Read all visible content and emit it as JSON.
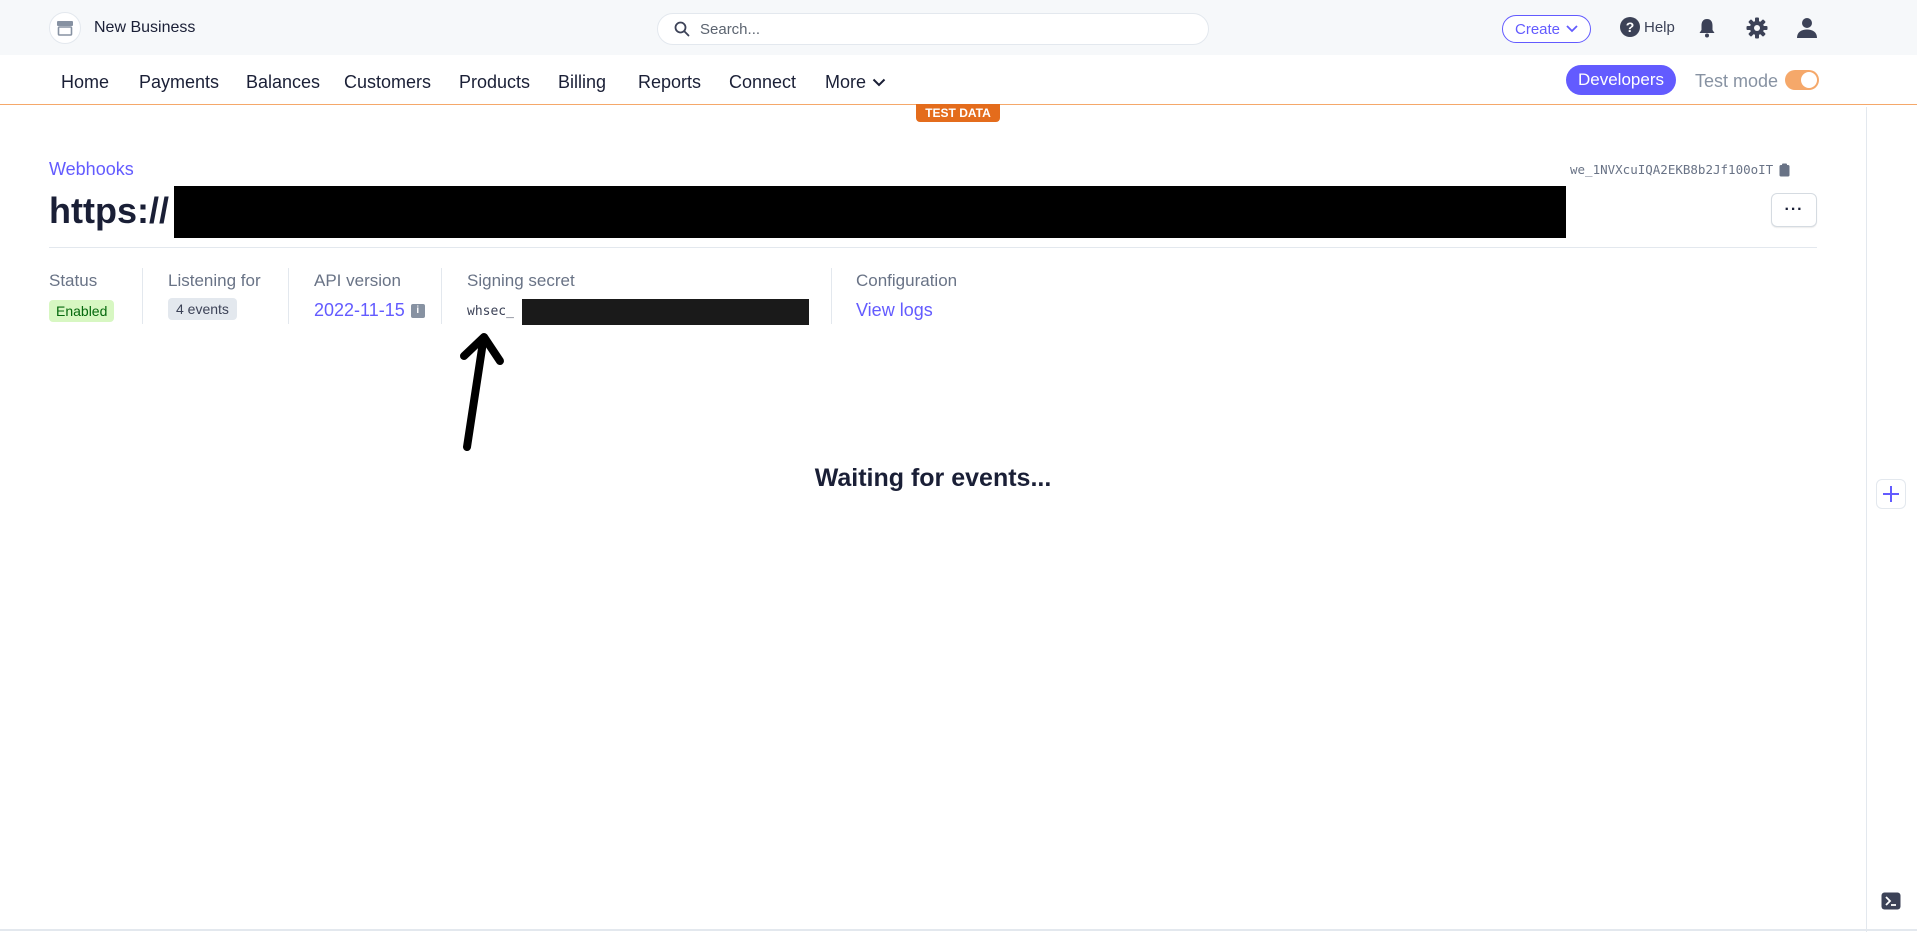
{
  "topbar": {
    "business_name": "New Business",
    "search_placeholder": "Search...",
    "create_label": "Create",
    "help_label": "Help"
  },
  "nav": {
    "items": [
      "Home",
      "Payments",
      "Balances",
      "Customers",
      "Products",
      "Billing",
      "Reports",
      "Connect"
    ],
    "more_label": "More",
    "developers_label": "Developers",
    "test_mode_label": "Test mode",
    "test_mode_on": true
  },
  "test_data_label": "TEST DATA",
  "webhook": {
    "breadcrumb": "Webhooks",
    "endpoint_id": "we_1NVXcuIQA2EKB8b2Jf100oIT",
    "title_prefix": "https://",
    "more_button": "···",
    "status_label": "Status",
    "status_value": "Enabled",
    "listening_label": "Listening for",
    "listening_value": "4 events",
    "api_label": "API version",
    "api_value": "2022-11-15",
    "secret_label": "Signing secret",
    "secret_prefix": "whsec_",
    "config_label": "Configuration",
    "view_logs": "View logs",
    "empty_state": "Waiting for events..."
  },
  "colors": {
    "accent": "#635bff",
    "test_mode": "#e46c1c",
    "enabled_bg": "#d7f7c2",
    "enabled_text": "#05690d"
  }
}
